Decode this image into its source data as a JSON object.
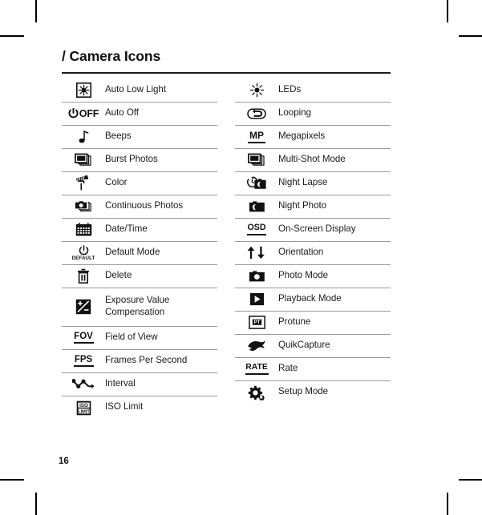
{
  "document": {
    "page_title": "/ Camera Icons",
    "page_number": "16",
    "accent_color": "#1a1a1a",
    "rule_color": "#9a9a9a"
  },
  "table": {
    "left_column": [
      {
        "icon": "auto-low-light-icon",
        "label": "Auto Low Light"
      },
      {
        "icon": "auto-off-icon",
        "label": "Auto Off"
      },
      {
        "icon": "beeps-icon",
        "label": "Beeps"
      },
      {
        "icon": "burst-photos-icon",
        "label": "Burst Photos"
      },
      {
        "icon": "color-icon",
        "label": "Color"
      },
      {
        "icon": "continuous-photos-icon",
        "label": "Continuous Photos"
      },
      {
        "icon": "date-time-icon",
        "label": "Date/Time"
      },
      {
        "icon": "default-mode-icon",
        "label": "Default Mode"
      },
      {
        "icon": "delete-icon",
        "label": "Delete"
      },
      {
        "icon": "exposure-value-icon",
        "label": "Exposure Value Compensation"
      },
      {
        "icon": "field-of-view-icon",
        "label": "Field of View"
      },
      {
        "icon": "frames-per-second-icon",
        "label": "Frames Per Second"
      },
      {
        "icon": "interval-icon",
        "label": "Interval"
      },
      {
        "icon": "iso-limit-icon",
        "label": "ISO Limit"
      }
    ],
    "right_column": [
      {
        "icon": "leds-icon",
        "label": "LEDs"
      },
      {
        "icon": "looping-icon",
        "label": "Looping"
      },
      {
        "icon": "megapixels-icon",
        "label": "Megapixels"
      },
      {
        "icon": "multi-shot-mode-icon",
        "label": "Multi-Shot Mode"
      },
      {
        "icon": "night-lapse-icon",
        "label": "Night Lapse"
      },
      {
        "icon": "night-photo-icon",
        "label": "Night Photo"
      },
      {
        "icon": "on-screen-display-icon",
        "label": "On-Screen Display"
      },
      {
        "icon": "orientation-icon",
        "label": "Orientation"
      },
      {
        "icon": "photo-mode-icon",
        "label": "Photo Mode"
      },
      {
        "icon": "playback-mode-icon",
        "label": "Playback Mode"
      },
      {
        "icon": "protune-icon",
        "label": "Protune"
      },
      {
        "icon": "quikcapture-icon",
        "label": "QuikCapture"
      },
      {
        "icon": "rate-icon",
        "label": "Rate"
      },
      {
        "icon": "setup-mode-icon",
        "label": "Setup Mode"
      }
    ]
  },
  "icon_text": {
    "auto_off": "OFF",
    "default_mode": "DEFAULT",
    "field_of_view": "FOV",
    "frames_per_second": "FPS",
    "iso_limit_top": "ISO",
    "iso_limit_bottom": "LIMIT",
    "megapixels": "MP",
    "on_screen_display": "OSD",
    "protune": "PT",
    "rate": "RATE"
  }
}
